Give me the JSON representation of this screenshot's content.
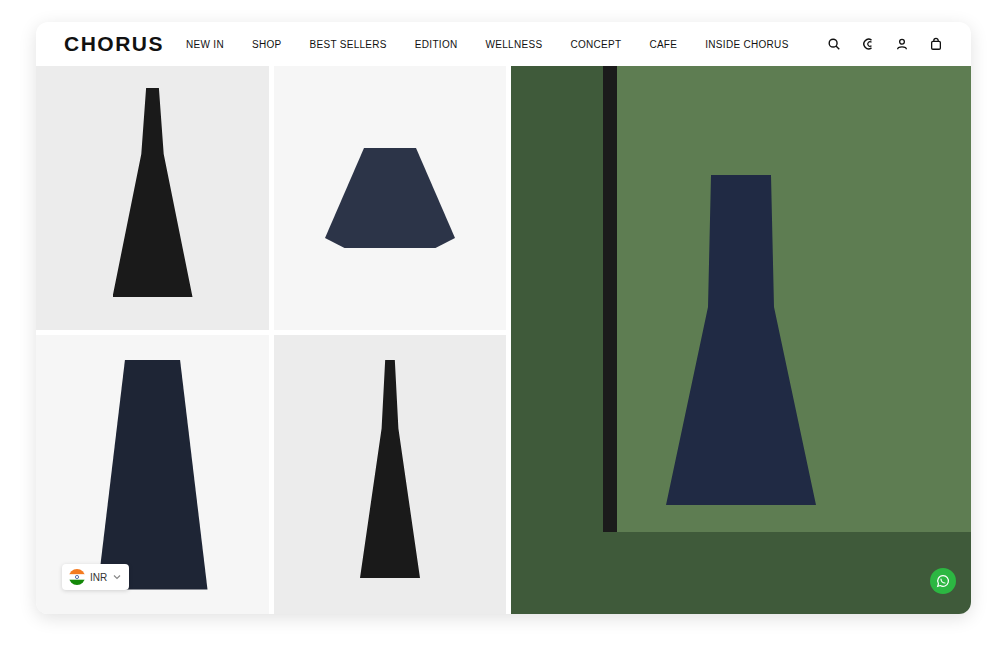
{
  "header": {
    "logo": "CHORUS",
    "nav": [
      {
        "label": "NEW IN"
      },
      {
        "label": "SHOP"
      },
      {
        "label": "BEST SELLERS"
      },
      {
        "label": "EDITION"
      },
      {
        "label": "WELLNESS"
      },
      {
        "label": "CONCEPT"
      },
      {
        "label": "CAFE"
      },
      {
        "label": "INSIDE CHORUS"
      }
    ]
  },
  "currency": {
    "code": "INR"
  }
}
